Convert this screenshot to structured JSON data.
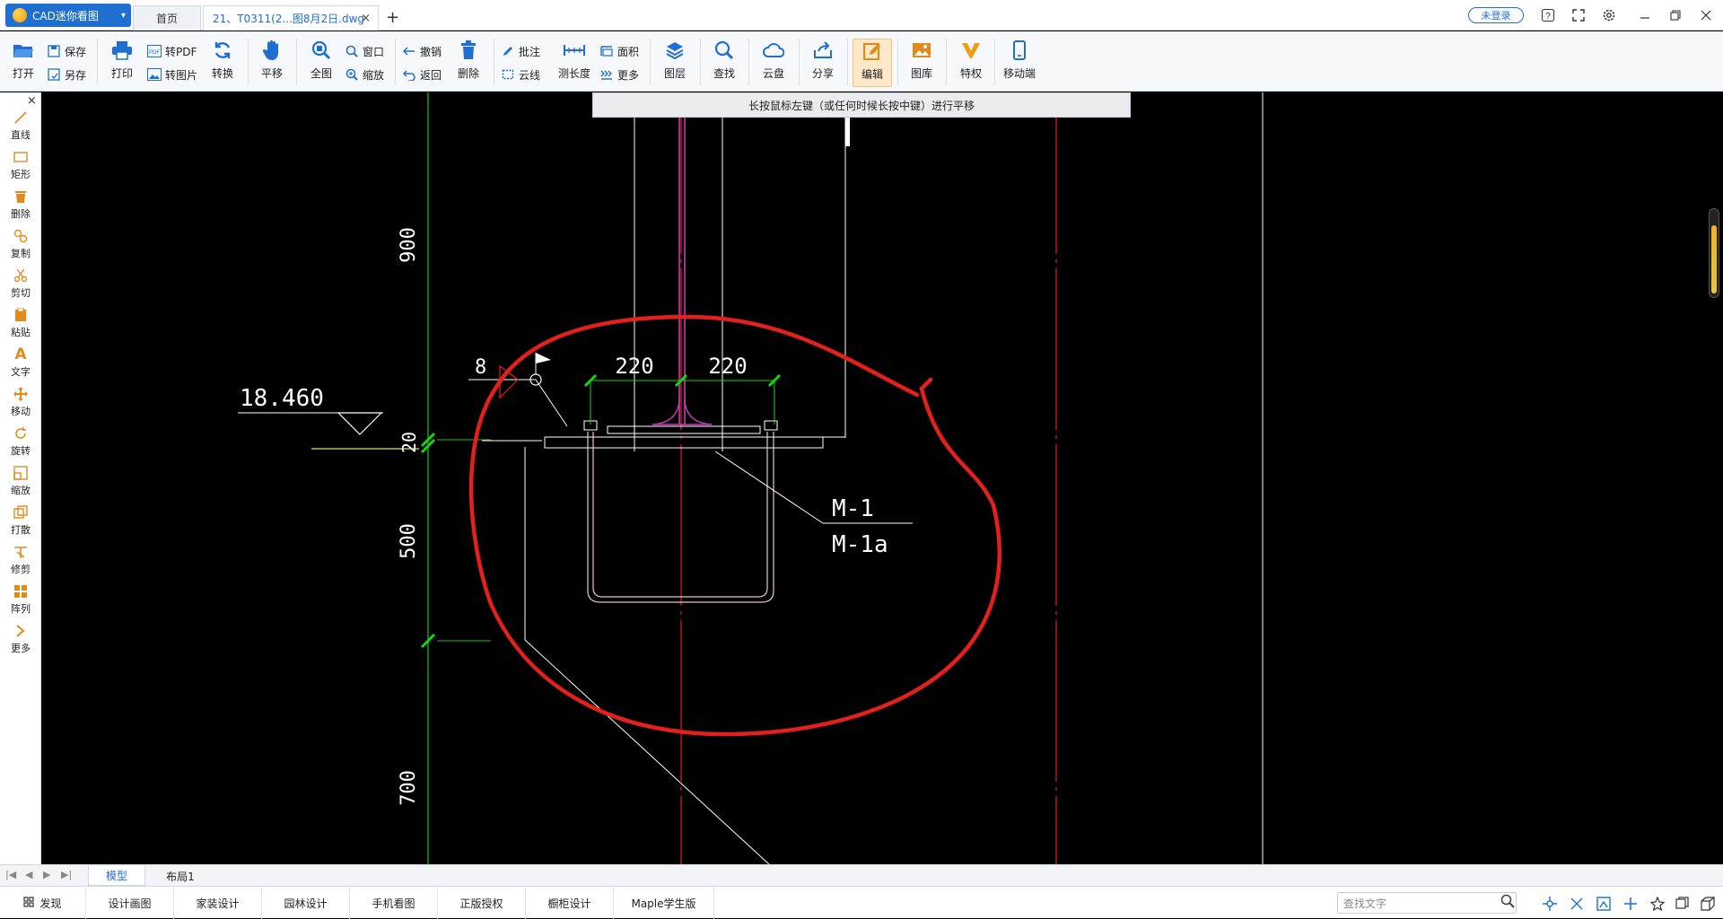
{
  "app": {
    "name": "CAD迷你看图",
    "tabs": {
      "home": "首页",
      "file": "21、T0311(2...图8月2日.dwg"
    },
    "login": "未登录"
  },
  "toolbar": {
    "open": "打开",
    "save": "保存",
    "saveas": "另存",
    "print": "打印",
    "topdf": "转PDF",
    "toimage": "转图片",
    "convert": "转换",
    "pan": "平移",
    "fullview": "全图",
    "window": "窗口",
    "zoom": "缩放",
    "undo": "撤销",
    "back": "返回",
    "delete": "删除",
    "annotate": "批注",
    "cloudline": "云线",
    "measure": "测长度",
    "area": "面积",
    "more": "更多",
    "layers": "图层",
    "find": "查找",
    "cloud": "云盘",
    "share": "分享",
    "edit": "编辑",
    "gallery": "图库",
    "privilege": "特权",
    "mobile": "移动端"
  },
  "left_tools": [
    "直线",
    "矩形",
    "删除",
    "复制",
    "剪切",
    "粘贴",
    "文字",
    "移动",
    "旋转",
    "缩放",
    "打散",
    "修剪",
    "阵列",
    "更多"
  ],
  "hint": "长按鼠标左键（或任何时候长按中键）进行平移",
  "drawing": {
    "dims": {
      "d900": "900",
      "d20": "20",
      "d500": "500",
      "d700": "700",
      "d220a": "220",
      "d220b": "220",
      "weld": "8"
    },
    "elevation": "18.460",
    "labels": {
      "m1": "M-1",
      "m1a": "M-1a"
    }
  },
  "layout_tabs": {
    "model": "模型",
    "layout1": "布局1"
  },
  "statusbar": {
    "discover": "发现",
    "links": [
      "设计画图",
      "家装设计",
      "园林设计",
      "手机看图",
      "正版授权",
      "橱柜设计",
      "Maple学生版"
    ],
    "find_placeholder": "查找文字"
  },
  "colors": {
    "accent": "#1f6fd1",
    "markup": "#e3201b",
    "dimension": "#19d414"
  }
}
